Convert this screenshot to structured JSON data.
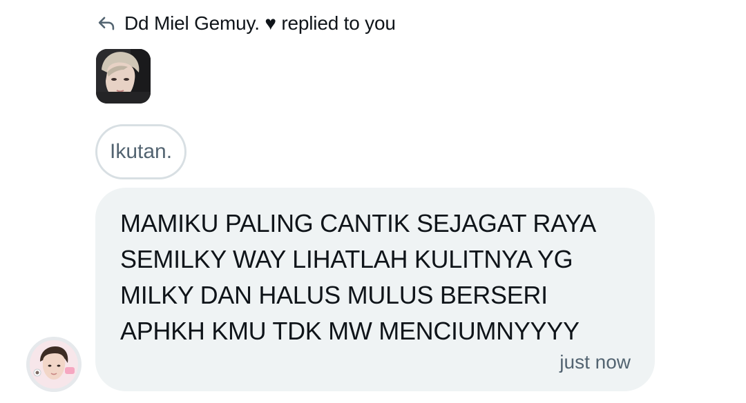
{
  "reply_header": {
    "icon": "reply-arrow-icon",
    "text": "Dd Miel Gemuy. ♥ replied to you"
  },
  "replied_media": {
    "icon": "profile-photo-thumbnail"
  },
  "quoted_message": {
    "text": "Ikutan."
  },
  "message": {
    "text": "MAMIKU PALING CANTIK SEJAGAT RAYA\nSEMILKY WAY LIHATLAH KULITNYA YG\nMILKY DAN HALUS MULUS BERSERI\nAPHKH KMU TDK MW MENCIUMNYYYY",
    "timestamp": "just now"
  },
  "sender": {
    "avatar_icon": "avatar"
  },
  "colors": {
    "bubble_bg": "#eff3f4",
    "text_primary": "#0f1419",
    "text_secondary": "#536471",
    "quoted_border": "#d8dfe3"
  }
}
